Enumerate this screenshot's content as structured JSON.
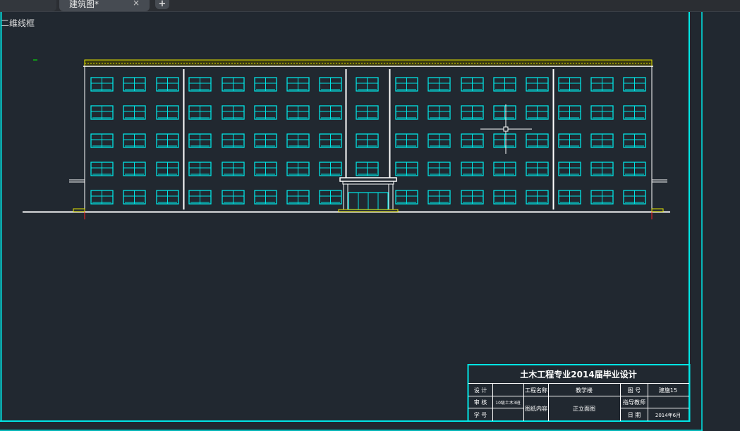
{
  "tabs": {
    "active_title": "建筑图*",
    "close_symbol": "×",
    "add_symbol": "+"
  },
  "viewport": {
    "label": "二维线框"
  },
  "title_block": {
    "heading": "土木工程专业2014届毕业设计",
    "row1": {
      "design": "设 计",
      "project_name_label": "工程名称",
      "project_name": "教学楼",
      "drawing_no_label": "图 号",
      "drawing_no": "建施15"
    },
    "row2": {
      "review": "审 核",
      "class_value": "10级土木3班",
      "content_label": "图纸内容",
      "content": "正立面图",
      "instructor_label": "指导教师"
    },
    "row3": {
      "student_no": "学 号",
      "date_label": "日 期",
      "date": "2014年6月"
    }
  },
  "colors": {
    "background": "#212830",
    "frame": "#00e5e5",
    "window": "#00e5e5",
    "outline": "#ffffff",
    "roof_hatch": "#e6e600",
    "axis_marker": "#ff2020"
  }
}
